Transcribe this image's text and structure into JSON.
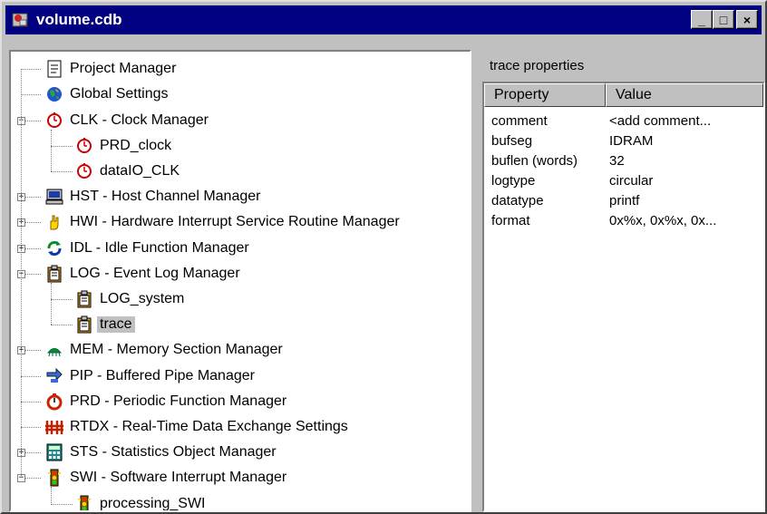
{
  "window": {
    "title": "volume.cdb",
    "minimize_glyph": "_",
    "maximize_glyph": "□",
    "close_glyph": "×"
  },
  "tree": {
    "items": [
      {
        "label": "Project Manager",
        "icon": "document-icon"
      },
      {
        "label": "Global Settings",
        "icon": "globe-icon"
      },
      {
        "label": "CLK - Clock Manager",
        "icon": "clock-icon",
        "expander": "−"
      },
      {
        "label": "PRD_clock",
        "icon": "clock-icon"
      },
      {
        "label": "dataIO_CLK",
        "icon": "clock-icon"
      },
      {
        "label": "HST - Host Channel Manager",
        "icon": "computer-icon",
        "expander": "+"
      },
      {
        "label": "HWI - Hardware Interrupt Service Routine Manager",
        "icon": "hand-icon",
        "expander": "+"
      },
      {
        "label": "IDL - Idle Function Manager",
        "icon": "loop-icon",
        "expander": "+"
      },
      {
        "label": "LOG - Event Log Manager",
        "icon": "clipboard-icon",
        "expander": "−"
      },
      {
        "label": "LOG_system",
        "icon": "clipboard-icon"
      },
      {
        "label": "trace",
        "icon": "clipboard-icon",
        "selected": true
      },
      {
        "label": "MEM - Memory Section Manager",
        "icon": "chip-icon",
        "expander": "+"
      },
      {
        "label": "PIP - Buffered Pipe Manager",
        "icon": "pipe-icon"
      },
      {
        "label": "PRD - Periodic Function Manager",
        "icon": "stopwatch-icon"
      },
      {
        "label": "RTDX - Real-Time Data Exchange Settings",
        "icon": "rtdx-icon"
      },
      {
        "label": "STS - Statistics Object Manager",
        "icon": "calculator-icon",
        "expander": "+"
      },
      {
        "label": "SWI - Software Interrupt Manager",
        "icon": "traffic-light-icon",
        "expander": "−"
      },
      {
        "label": "processing_SWI",
        "icon": "traffic-light-icon"
      }
    ]
  },
  "properties": {
    "header": "trace properties",
    "columns": [
      "Property",
      "Value"
    ],
    "rows": [
      {
        "name": "comment",
        "value": "<add comment..."
      },
      {
        "name": "bufseg",
        "value": "IDRAM"
      },
      {
        "name": "buflen (words)",
        "value": "32"
      },
      {
        "name": "logtype",
        "value": "circular"
      },
      {
        "name": "datatype",
        "value": "printf"
      },
      {
        "name": "format",
        "value": "0x%x, 0x%x, 0x..."
      }
    ]
  }
}
